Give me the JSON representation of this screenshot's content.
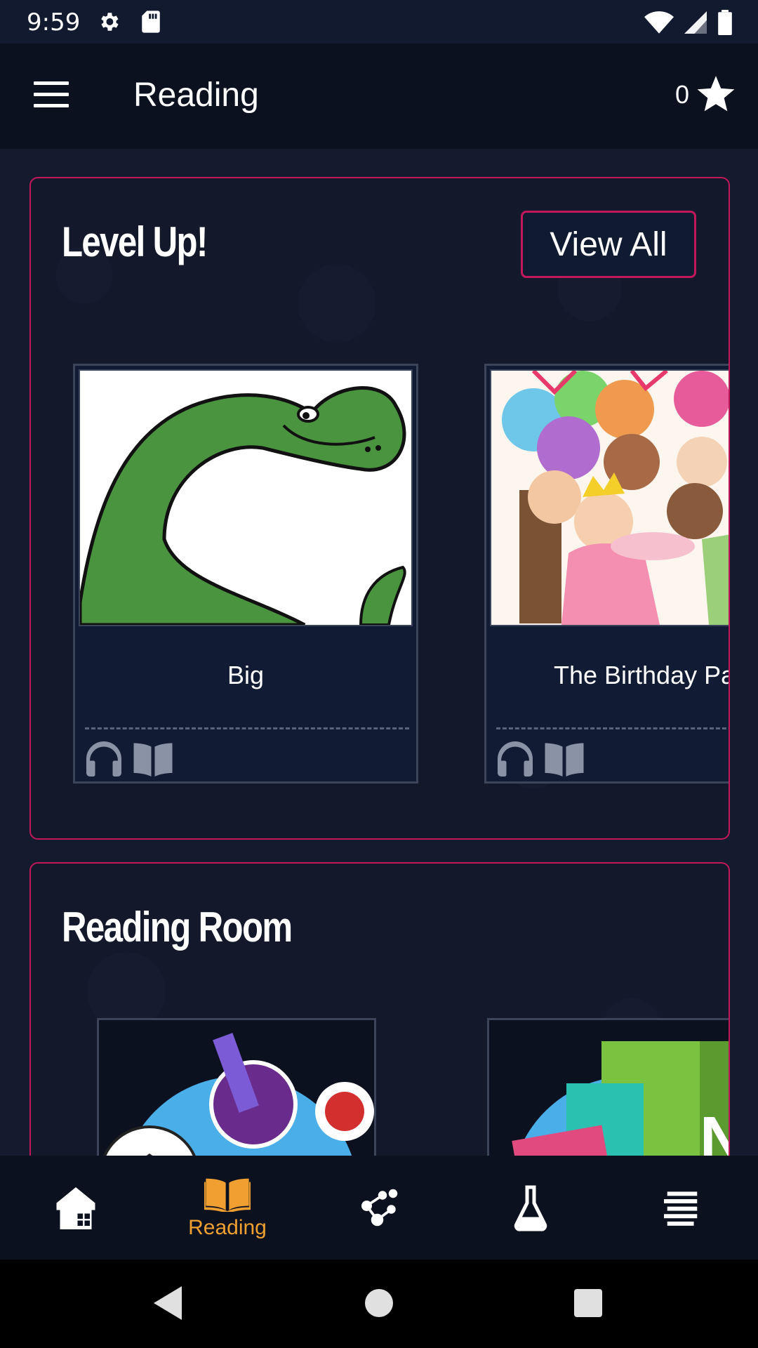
{
  "status": {
    "time": "9:59"
  },
  "app_bar": {
    "title": "Reading",
    "star_count": "0"
  },
  "level_up": {
    "title": "Level Up!",
    "view_all_label": "View All",
    "books": [
      {
        "title": "Big"
      },
      {
        "title": "The Birthday Pa"
      }
    ]
  },
  "reading_room": {
    "title": "Reading Room"
  },
  "bottom_nav": {
    "items": [
      {
        "icon": "home-icon",
        "label": ""
      },
      {
        "icon": "book-icon",
        "label": "Reading"
      },
      {
        "icon": "molecule-icon",
        "label": ""
      },
      {
        "icon": "flask-icon",
        "label": ""
      },
      {
        "icon": "list-icon",
        "label": ""
      }
    ],
    "active_color": "#f0a030"
  },
  "colors": {
    "accent": "#c2185b",
    "background": "#0c1120",
    "active": "#f0a030"
  }
}
